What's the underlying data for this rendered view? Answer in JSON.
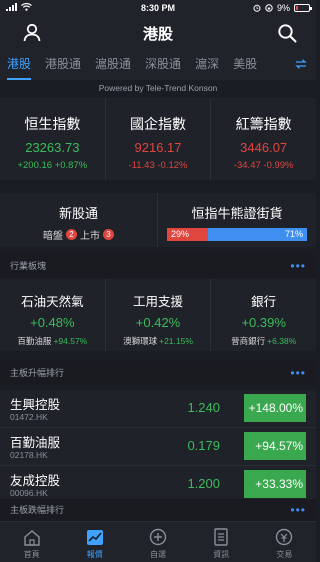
{
  "status_bar": {
    "time": "8:30 PM",
    "battery": "9%"
  },
  "header": {
    "title": "港股"
  },
  "tabs": [
    "港股",
    "港股通",
    "滬股通",
    "深股通",
    "滬深",
    "美股"
  ],
  "powered_by": "Powered by Tele-Trend Konson",
  "indices": [
    {
      "name": "恒生指數",
      "value": "23263.73",
      "change": "+200.16 +0.87%",
      "direction": "up"
    },
    {
      "name": "國企指數",
      "value": "9216.17",
      "change": "-11.43 -0.12%",
      "direction": "down"
    },
    {
      "name": "紅籌指數",
      "value": "3446.07",
      "change": "-34.47 -0.99%",
      "direction": "down"
    }
  ],
  "ipo": {
    "title": "新股通",
    "grey_label": "暗盤",
    "grey_count": "2",
    "listed_label": "上市",
    "listed_count": "3"
  },
  "cbbc": {
    "title": "恒指牛熊證街貨",
    "bull_pct": "29%",
    "bear_pct": "71%",
    "bull_fraction": 0.29
  },
  "sector_section": {
    "title": "行業板塊"
  },
  "sectors": [
    {
      "name": "石油天然氣",
      "change": "+0.48%",
      "leader": "百勤油服",
      "leader_change": "+94.57%"
    },
    {
      "name": "工用支援",
      "change": "+0.42%",
      "leader": "澳獅環球",
      "leader_change": "+21.15%"
    },
    {
      "name": "銀行",
      "change": "+0.39%",
      "leader": "晉商銀行",
      "leader_change": "+6.38%"
    }
  ],
  "gainers_section": {
    "title": "主板升幅排行"
  },
  "gainers": [
    {
      "name": "生興控股",
      "code": "01472.HK",
      "price": "1.240",
      "pct": "+148.00%"
    },
    {
      "name": "百勤油服",
      "code": "02178.HK",
      "price": "0.179",
      "pct": "+94.57%"
    },
    {
      "name": "友成控股",
      "code": "00096.HK",
      "price": "1.200",
      "pct": "+33.33%"
    }
  ],
  "losers_section": {
    "title": "主板跌幅排行"
  },
  "tabbar": [
    "首頁",
    "報價",
    "自選",
    "資訊",
    "交易"
  ],
  "colors": {
    "up": "#3bbd5a",
    "down": "#e0453e",
    "accent": "#3fa2ff"
  }
}
